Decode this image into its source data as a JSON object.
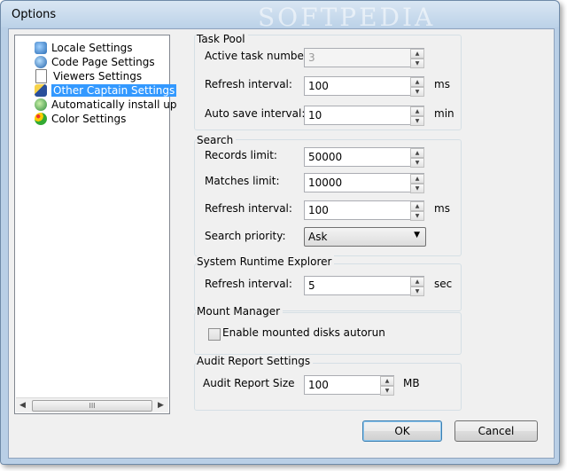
{
  "window": {
    "title": "Options",
    "watermark": "SOFTPEDIA"
  },
  "tree": {
    "items": [
      {
        "label": "Locale Settings",
        "icon": "globe-arrow-icon",
        "selected": false
      },
      {
        "label": "Code Page Settings",
        "icon": "globe-icon",
        "selected": false
      },
      {
        "label": "Viewers Settings",
        "icon": "document-icon",
        "selected": false
      },
      {
        "label": "Other Captain Settings",
        "icon": "pencil-ruler-icon",
        "selected": true
      },
      {
        "label": "Automatically install updates",
        "icon": "update-globe-icon",
        "selected": false
      },
      {
        "label": "Color Settings",
        "icon": "palette-icon",
        "selected": false
      }
    ],
    "scroll_thumb_glyph": "III"
  },
  "task_pool": {
    "title": "Task Pool",
    "active_task_label": "Active task number:",
    "active_task_value": "3",
    "refresh_label": "Refresh interval:",
    "refresh_value": "100",
    "refresh_unit": "ms",
    "autosave_label": "Auto save interval:",
    "autosave_value": "10",
    "autosave_unit": "min"
  },
  "search": {
    "title": "Search",
    "records_label": "Records limit:",
    "records_value": "50000",
    "matches_label": "Matches limit:",
    "matches_value": "10000",
    "refresh_label": "Refresh interval:",
    "refresh_value": "100",
    "refresh_unit": "ms",
    "priority_label": "Search priority:",
    "priority_value": "Ask"
  },
  "runtime": {
    "title": "System Runtime Explorer",
    "refresh_label": "Refresh interval:",
    "refresh_value": "5",
    "refresh_unit": "sec"
  },
  "mount": {
    "title": "Mount Manager",
    "autorun_label": "Enable mounted disks autorun",
    "autorun_checked": false
  },
  "audit": {
    "title": "Audit Report Settings",
    "size_label": "Audit Report Size",
    "size_value": "100",
    "size_unit": "MB"
  },
  "buttons": {
    "ok": "OK",
    "cancel": "Cancel"
  },
  "colors": {
    "selection": "#3399ff",
    "frame": "#b9cfe6"
  }
}
